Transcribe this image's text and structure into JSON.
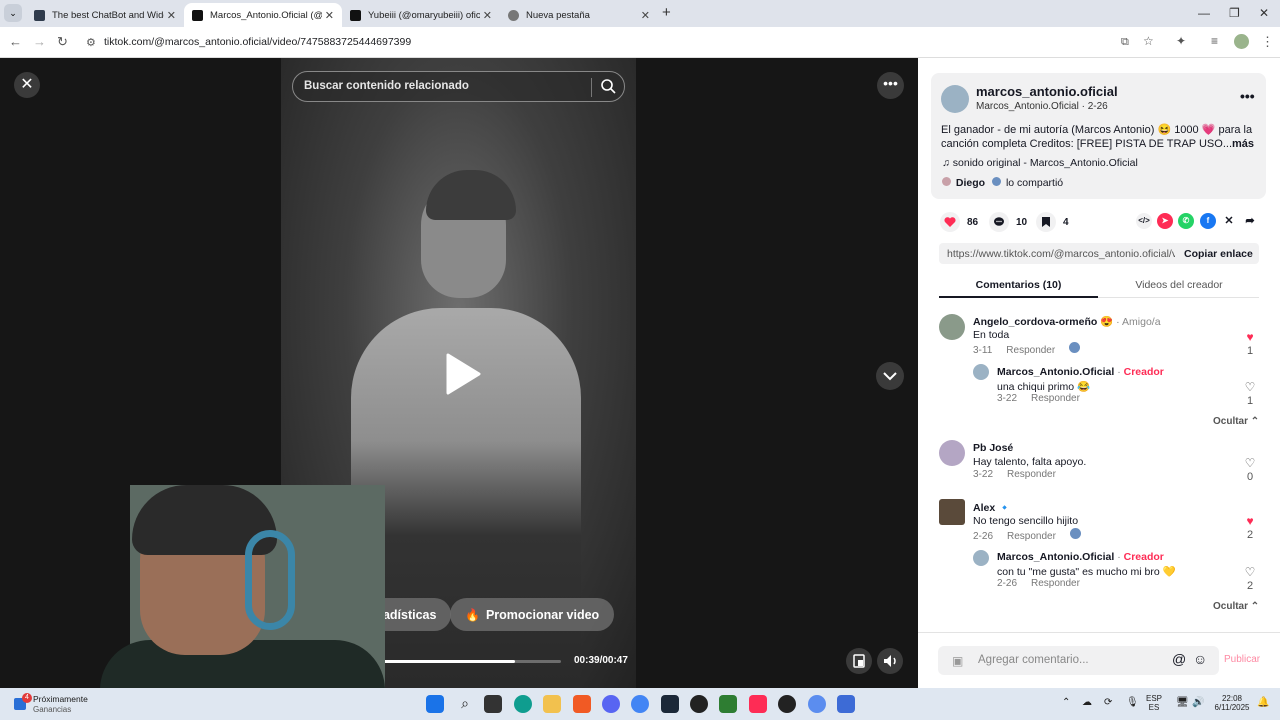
{
  "browser": {
    "tabs": [
      {
        "title": "The best ChatBot and Widgets",
        "active": false
      },
      {
        "title": "Marcos_Antonio.Oficial (@marcos",
        "active": true
      },
      {
        "title": "Yubeiii (@omaryubeiii) oficial | T",
        "active": false
      },
      {
        "title": "Nueva pestaña",
        "active": false
      }
    ],
    "url": "tiktok.com/@marcos_antonio.oficial/video/7475883725444697399"
  },
  "video": {
    "search_placeholder": "Buscar contenido relacionado",
    "stats_button": "Ver estadísticas",
    "promote_button": "Promocionar video",
    "time": "00:39/00:47",
    "progress": 0.83
  },
  "post": {
    "username": "marcos_antonio.oficial",
    "subline": "Marcos_Antonio.Oficial · 2-26",
    "description": "El ganador - de mi autoría (Marcos Antonio) 😆 1000 💗 para la canción completa Creditos: [FREE] PISTA DE TRAP USO...",
    "more": "más",
    "sound": "sonido original - Marcos_Antonio.Oficial",
    "shared_by": "Diego",
    "shared_text": "lo compartió",
    "likes": "86",
    "comments": "10",
    "saves": "4",
    "link": "https://www.tiktok.com/@marcos_antonio.oficial/vi...",
    "copy_link": "Copiar enlace"
  },
  "tabs": {
    "comments": "Comentarios (10)",
    "creator_videos": "Videos del creador"
  },
  "comments": [
    {
      "name": "Angelo_cordova-ormeño 😍",
      "tag": " · Amigo/a",
      "text": "En toda",
      "date": "3-11",
      "reply": "Responder",
      "likes": "1",
      "liked": true,
      "replies": [
        {
          "name": "Marcos_Antonio.Oficial",
          "tag": " · ",
          "creator": "Creador",
          "text": "una chiqui primo 😂",
          "date": "3-22",
          "reply": "Responder",
          "likes": "1",
          "liked": false
        }
      ],
      "hide": "Ocultar ⌃"
    },
    {
      "name": "Pb José",
      "tag": "",
      "text": "Hay talento, falta apoyo.",
      "date": "3-22",
      "reply": "Responder",
      "likes": "0",
      "liked": false,
      "replies": [],
      "hide": ""
    },
    {
      "name": "Alex 🔹",
      "tag": "",
      "text": "No tengo sencillo hijito",
      "date": "2-26",
      "reply": "Responder",
      "likes": "2",
      "liked": true,
      "replies": [
        {
          "name": "Marcos_Antonio.Oficial",
          "tag": " · ",
          "creator": "Creador",
          "text": "con tu \"me gusta\" es mucho mi bro 💛",
          "date": "2-26",
          "reply": "Responder",
          "likes": "2",
          "liked": false
        }
      ],
      "hide": "Ocultar ⌃"
    }
  ],
  "comment_input": {
    "placeholder": "Agregar comentario...",
    "publish": "Publicar"
  },
  "taskbar": {
    "widget_title": "Próximamente",
    "widget_sub": "Ganancias",
    "widget_badge": "4",
    "lang1": "ESP",
    "lang2": "ES",
    "time": "22:08",
    "date": "6/11/2025"
  },
  "colors": {
    "accent": "#fe2c55",
    "dark_stage": "#161616"
  }
}
